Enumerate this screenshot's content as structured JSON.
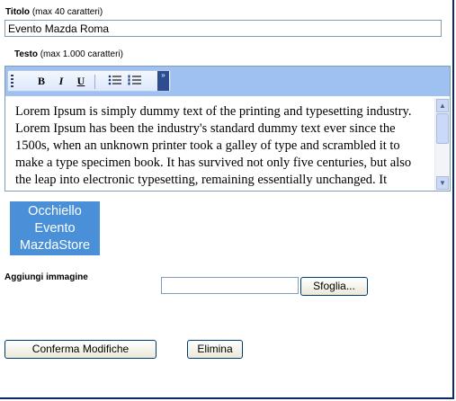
{
  "form": {
    "title_label": "Titolo",
    "title_hint": "(max 40 caratteri)",
    "title_value": "Evento Mazda Roma",
    "text_label": "Testo",
    "text_hint": "(max 1.000 caratteri)",
    "body_text": "Lorem Ipsum is simply dummy text of the printing and typesetting industry. Lorem Ipsum has been the industry's standard dummy text ever since the 1500s, when an unknown printer took a galley of type and scrambled it to make a type specimen book. It has survived not only five centuries, but also the leap into electronic typesetting, remaining essentially unchanged. It",
    "image_label": "Aggiungi immagine",
    "image_path_value": "",
    "browse_label": "Sfoglia...",
    "confirm_label": "Conferma Modifiche",
    "delete_label": "Elimina"
  },
  "toolbar": {
    "bold": "B",
    "italic": "I",
    "underline": "U",
    "overflow": "»"
  },
  "logo": {
    "line1": "Occhiello",
    "line2": "Evento",
    "line3": "MazdaStore",
    "bg_color": "#4a90d9"
  },
  "icons": {
    "toolbar_grip": "grip-icon",
    "bullets": "bulleted-list-icon",
    "numbers": "numbered-list-icon",
    "scroll_up": "chevron-up-icon",
    "scroll_down": "chevron-down-icon"
  }
}
